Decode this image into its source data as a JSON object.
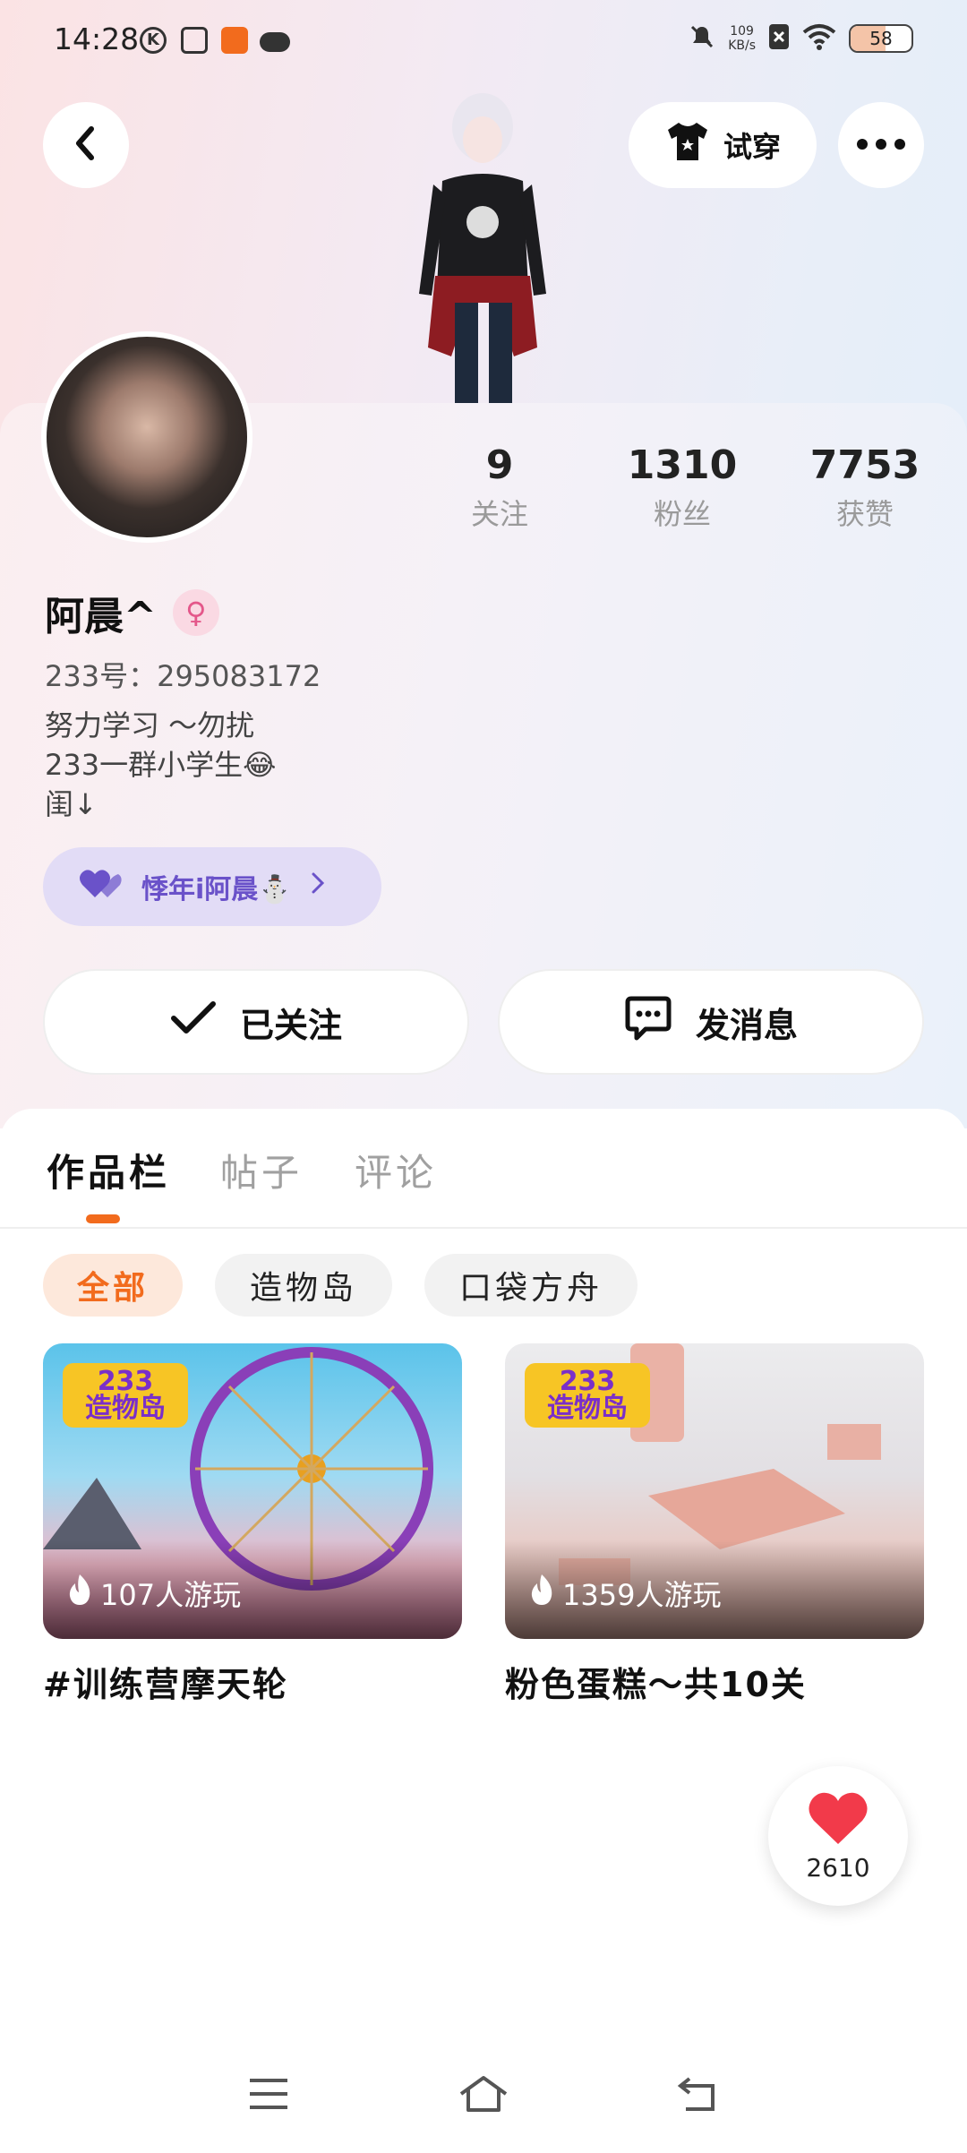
{
  "status_bar": {
    "time": "14:28",
    "net_speed_value": "109",
    "net_speed_unit": "KB/s",
    "battery": "58",
    "battery_level": 0.58
  },
  "header": {
    "try_on_label": "试穿"
  },
  "profile": {
    "name": "阿晨^",
    "gender_icon": "female-icon",
    "account_id": "233号：295083172",
    "bio": "努力学习 ～勿扰\n233一群小学生😂\n闺↓",
    "stats": [
      {
        "value": "9",
        "label": "关注"
      },
      {
        "value": "1310",
        "label": "粉丝"
      },
      {
        "value": "7753",
        "label": "获赞"
      }
    ],
    "group_pill": "悸年i阿晨⛄",
    "follow_button": "已关注",
    "message_button": "发消息"
  },
  "tabs": [
    {
      "label": "作品栏",
      "active": true
    },
    {
      "label": "帖子",
      "active": false
    },
    {
      "label": "评论",
      "active": false
    }
  ],
  "filters": [
    {
      "label": "全部",
      "active": true
    },
    {
      "label": "造物岛",
      "active": false
    },
    {
      "label": "口袋方舟",
      "active": false
    }
  ],
  "works": [
    {
      "logo": "233\n造物岛",
      "plays": "107人游玩",
      "title": "#训练营摩天轮"
    },
    {
      "logo": "233\n造物岛",
      "plays": "1359人游玩",
      "title": "粉色蛋糕～共10关"
    }
  ],
  "like_fab": {
    "count": "2610"
  },
  "colors": {
    "accent": "#f26b1d",
    "group_purple": "#6a52c9",
    "heart": "#f23a4a"
  }
}
